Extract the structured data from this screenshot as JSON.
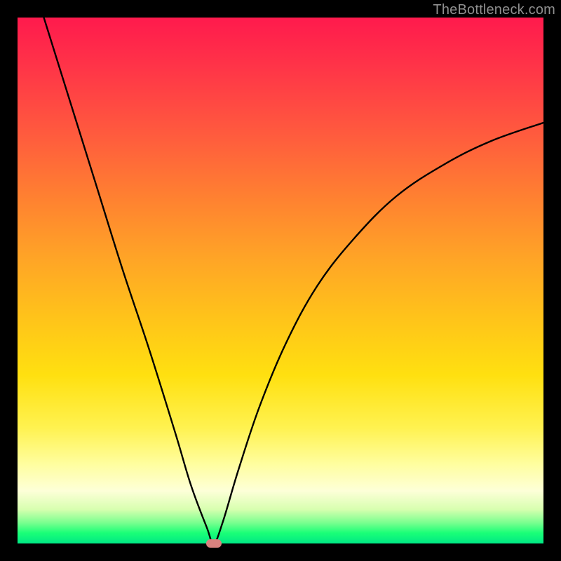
{
  "watermark": "TheBottleneck.com",
  "chart_data": {
    "type": "line",
    "title": "",
    "xlabel": "",
    "ylabel": "",
    "xlim": [
      0,
      100
    ],
    "ylim": [
      0,
      100
    ],
    "series": [
      {
        "name": "bottleneck-curve",
        "x": [
          5,
          10,
          15,
          20,
          25,
          30,
          33,
          36,
          37.3,
          39,
          42,
          46,
          51,
          57,
          64,
          72,
          81,
          90,
          100
        ],
        "values": [
          100,
          84,
          68,
          52,
          37,
          21,
          11,
          3,
          0,
          4,
          14,
          26,
          38,
          49,
          58,
          66,
          72,
          76.5,
          80
        ]
      }
    ],
    "marker": {
      "x": 37.3,
      "y": 0
    },
    "gradient_stops": [
      {
        "pos": 0,
        "color": "#ff1a4d"
      },
      {
        "pos": 0.5,
        "color": "#ffc31a"
      },
      {
        "pos": 0.9,
        "color": "#fdffd8"
      },
      {
        "pos": 1.0,
        "color": "#00e884"
      }
    ]
  }
}
